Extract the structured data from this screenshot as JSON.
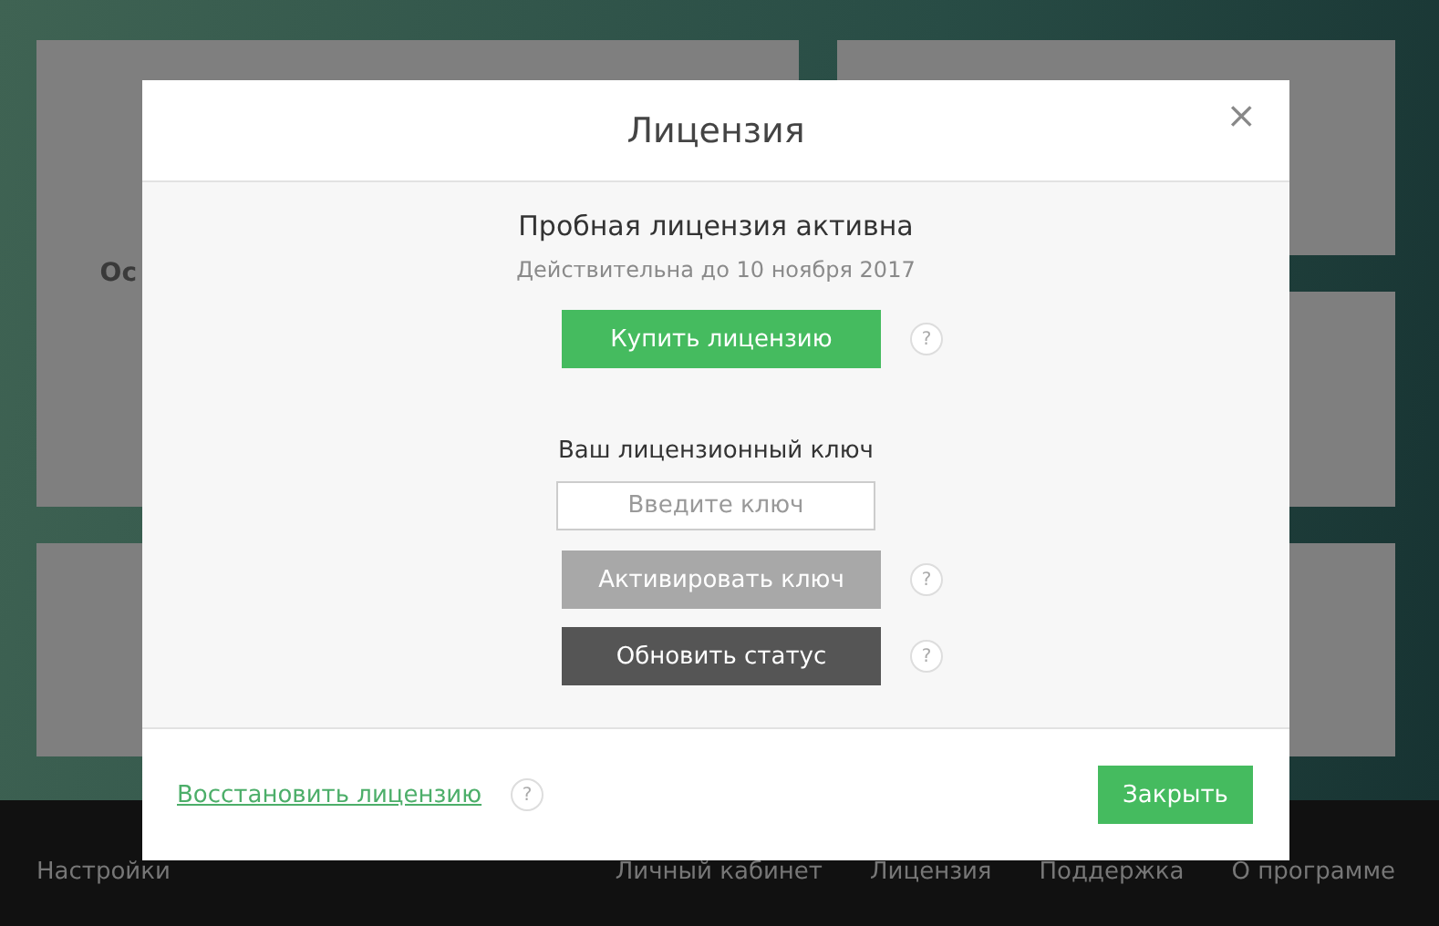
{
  "background": {
    "tile_text": "Ос",
    "nav_left": "Настройки",
    "nav_right": [
      "Личный кабинет",
      "Лицензия",
      "Поддержка",
      "О программе"
    ]
  },
  "dialog": {
    "title": "Лицензия",
    "close": "×",
    "status": "Пробная лицензия активна",
    "valid_until": "Действительна до 10 ноября 2017",
    "buy": {
      "label": "Купить лицензию",
      "help": "?"
    },
    "key_label": "Ваш лицензионный ключ",
    "key_field": {
      "placeholder": "Введите ключ"
    },
    "activate": {
      "label": "Активировать ключ",
      "help": "?"
    },
    "refresh": {
      "label": "Обновить статус",
      "help": "?"
    },
    "restore": {
      "label": "Восстановить лицензию",
      "help": "?"
    },
    "close_button": "Закрыть"
  }
}
